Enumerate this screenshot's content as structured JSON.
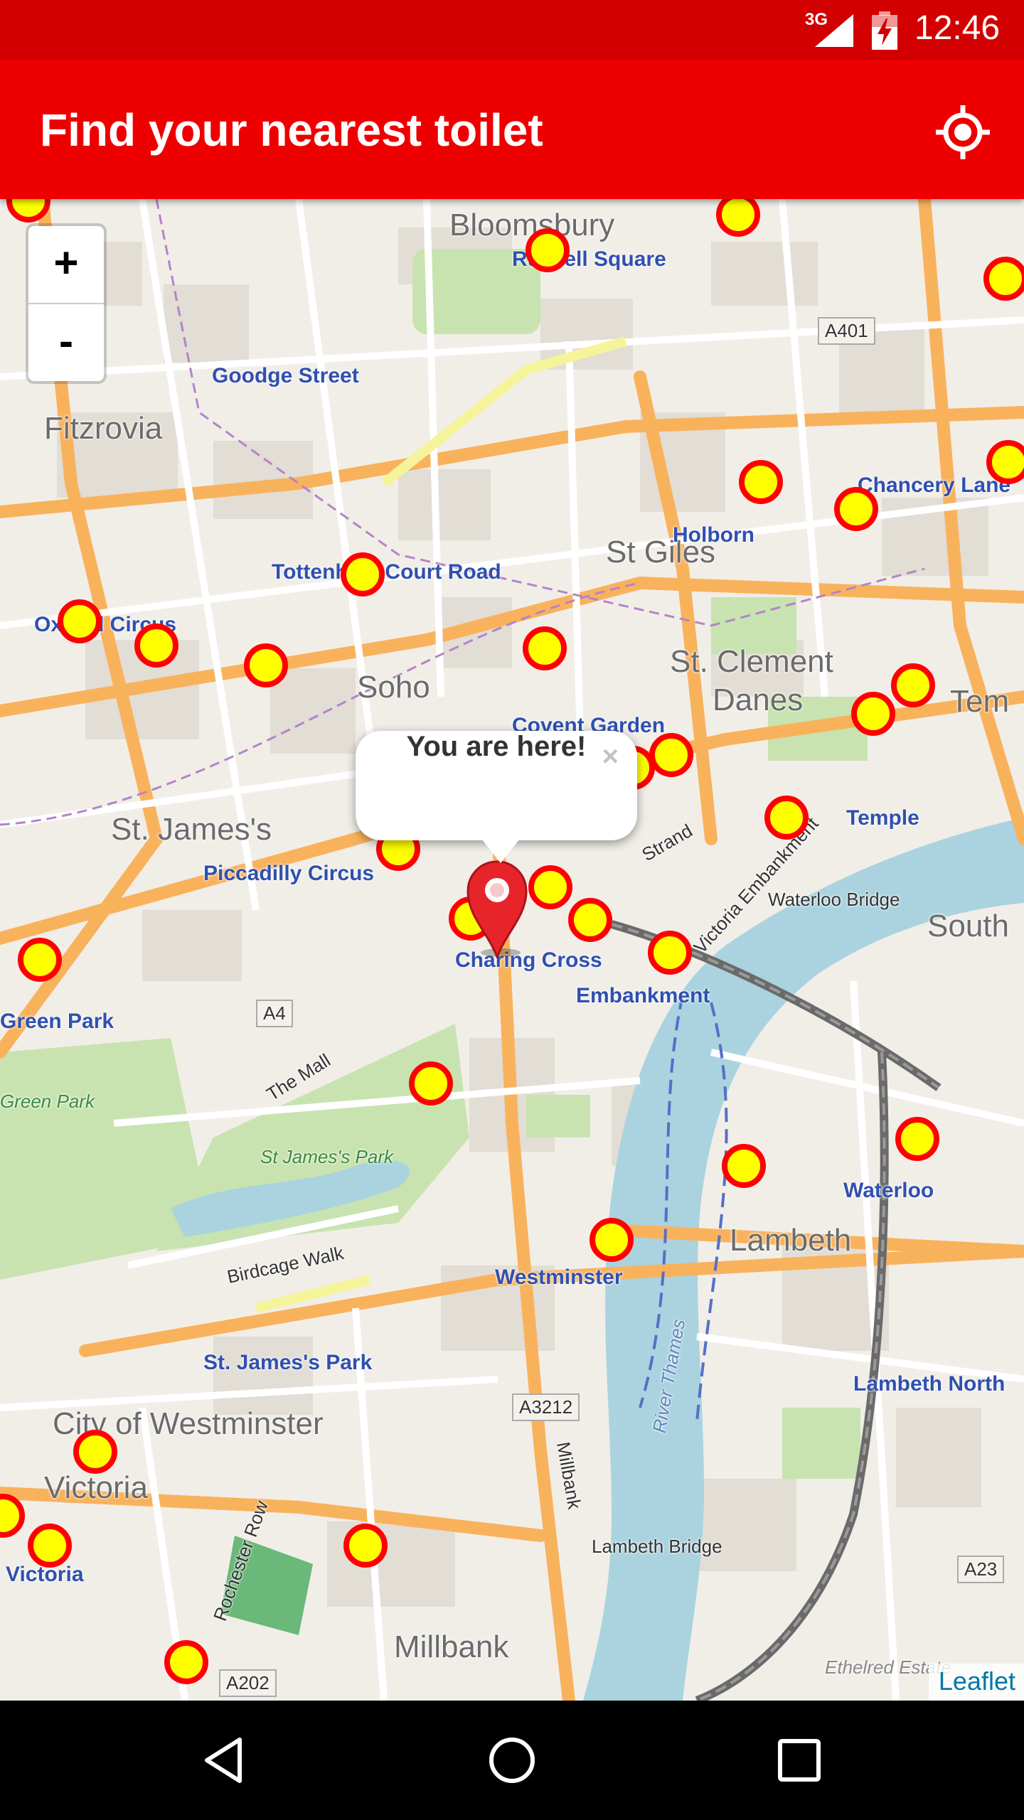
{
  "status_bar": {
    "network": "3G",
    "time": "12:46",
    "icons": [
      "signal-icon",
      "battery-charging-icon"
    ]
  },
  "app_bar": {
    "title": "Find your nearest toilet",
    "locate_icon": "gps-locate-icon"
  },
  "map": {
    "zoom_in_label": "+",
    "zoom_out_label": "-",
    "popup_text": "You are here!",
    "popup_close": "×",
    "attribution": "Leaflet",
    "districts": [
      "Bloomsbury",
      "Fitzrovia",
      "St Giles",
      "St. Clement",
      "Danes",
      "Soho",
      "St. James's",
      "Lambeth",
      "City of Westminster",
      "Victoria",
      "Millbank",
      "South",
      "Tem"
    ],
    "stations": [
      "Russell Square",
      "Goodge Street",
      "Chancery Lane",
      "Holborn",
      "Tottenham Court Road",
      "Oxford Circus",
      "Covent Garden",
      "Temple",
      "Piccadilly Circus",
      "Charing Cross",
      "Embankment",
      "Green Park",
      "Waterloo",
      "Westminster",
      "St. James's Park",
      "Lambeth North",
      "Victoria"
    ],
    "roads": [
      "A401",
      "A4",
      "A3212",
      "A23",
      "A202",
      "The Mall",
      "Birdcage Walk",
      "Strand",
      "Victoria Embankment",
      "Millbank",
      "Rochester Row",
      "Waterloo Bridge",
      "Lambeth Bridge",
      "River Thames",
      "St James's Park",
      "Green Park",
      "Ethelred Estate"
    ],
    "toilet_marker_count": 29
  },
  "nav_bar": {
    "back_icon": "back-triangle-icon",
    "home_icon": "home-circle-icon",
    "recent_icon": "recent-apps-square-icon"
  },
  "colors": {
    "status_bar": "#d20000",
    "app_bar": "#ee0000",
    "marker_fill": "#ffff00",
    "marker_stroke": "#ff0000",
    "you_marker": "#e8242b",
    "water": "#aad3df",
    "park": "#c8e3b0"
  }
}
